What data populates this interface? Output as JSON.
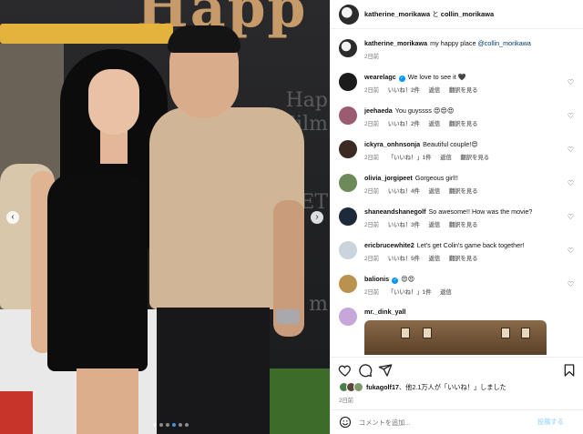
{
  "media": {
    "sign_text": "Happ",
    "wall_texts": [
      "Hap",
      "Gilm",
      "ET",
      "m"
    ],
    "carousel": {
      "total_slides": 6,
      "current_slide": 4
    }
  },
  "post": {
    "header_user1": "katherine_morikawa",
    "header_sep": " と ",
    "header_user2": "collin_morikawa",
    "caption_user": "katherine_morikawa",
    "caption_text": "my happy place",
    "caption_mention": "@collin_morikawa",
    "caption_time": "2日前",
    "likes_user": "fukagolf17",
    "likes_text": "、他2.1万人が「いいね！」しました",
    "date": "2日前",
    "comment_placeholder": "コメントを追加...",
    "post_button": "投稿する"
  },
  "comments": [
    {
      "user": "wearelagc",
      "verified": true,
      "text": "We love to see it 🖤",
      "time": "2日前",
      "likes": "いいね！2件",
      "reply": "返信",
      "view_replies": "翻訳を見る",
      "avatar_color": "#1b1b1b"
    },
    {
      "user": "jeehaeda",
      "verified": false,
      "text": "You guyssss 😍😍😍",
      "time": "2日前",
      "likes": "いいね！2件",
      "reply": "返信",
      "view_replies": "翻訳を見る",
      "avatar_color": "#9a5c6e"
    },
    {
      "user": "ickyra_onhnsonja",
      "verified": false,
      "text": "Beautiful couple!😍",
      "time": "2日前",
      "likes": "「いいね！」1件",
      "reply": "返信",
      "view_replies": "翻訳を見る",
      "avatar_color": "#3b2a22"
    },
    {
      "user": "olivia_jorgipeet",
      "verified": false,
      "text": "Gorgeous girl!!",
      "time": "2日前",
      "likes": "いいね！4件",
      "reply": "返信",
      "view_replies": "翻訳を見る",
      "avatar_color": "#6e8a5a"
    },
    {
      "user": "shaneandshanegolf",
      "verified": false,
      "text": "So awesome!! How was the movie?",
      "time": "2日前",
      "likes": "いいね！3件",
      "reply": "返信",
      "view_replies": "翻訳を見る",
      "avatar_color": "#1e2a3a"
    },
    {
      "user": "ericbrucewhite2",
      "verified": false,
      "text": "Let's get Colin's game back together!",
      "time": "2日前",
      "likes": "いいね！5件",
      "reply": "返信",
      "view_replies": "翻訳を見る",
      "avatar_color": "#c9d4dc"
    },
    {
      "user": "balionis",
      "verified": true,
      "text": "😍😍",
      "time": "2日前",
      "likes": "「いいね！」1件",
      "reply": "返信",
      "view_replies": "",
      "avatar_color": "#b9934e"
    },
    {
      "user": "mr._dink_yall",
      "verified": false,
      "text": "",
      "time": "",
      "likes": "",
      "reply": "",
      "view_replies": "",
      "avatar_color": "#c7a6d9"
    }
  ],
  "colors": {
    "link": "#00376b",
    "verified": "#0095f6",
    "meta_gray": "#737373",
    "post_button_disabled": "#b2dffc",
    "carousel_active": "#3897f0"
  },
  "icons": {
    "prev": "chevron-left-icon",
    "next": "chevron-right-icon",
    "like": "heart-icon",
    "comment": "comment-icon",
    "share": "send-icon",
    "save": "bookmark-icon",
    "emoji": "smiley-icon"
  }
}
